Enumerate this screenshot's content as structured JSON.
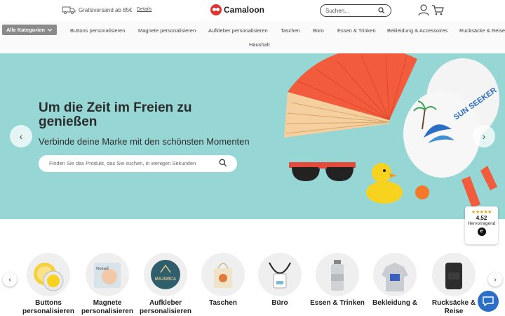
{
  "topbar": {
    "shipping_text": "Gratisversand ab 85€",
    "details_link": "Details",
    "logo_text": "Camaloon",
    "search_placeholder": "Suchen..."
  },
  "nav": {
    "all_categories": "Alle Kategorien",
    "items": [
      "Buttons personalisieren",
      "Magnete personalisieren",
      "Aufkleber personalisieren",
      "Taschen",
      "Büro",
      "Essen & Trinken",
      "Bekleidung & Accessoires",
      "Rucksäcke & Reise",
      "Haushalt"
    ]
  },
  "hero": {
    "title": "Um die Zeit im Freien zu genießen",
    "subtitle": "Verbinde deine Marke mit den schönsten Momenten",
    "search_placeholder": "Finden Sie das Produkt, das Sie suchen, in wenigen Sekunden",
    "prev_arrow": "‹",
    "next_arrow": "›",
    "paddle_text": "SUN SEEKER"
  },
  "rating": {
    "stars": "★★★★★",
    "score": "4,52",
    "label": "Hervorragend",
    "badge_letter": "e"
  },
  "categories": [
    {
      "label": "Buttons personalisieren"
    },
    {
      "label": "Magnete personalisieren"
    },
    {
      "label": "Aufkleber personalisieren"
    },
    {
      "label": "Taschen"
    },
    {
      "label": "Büro"
    },
    {
      "label": "Essen & Trinken"
    },
    {
      "label": "Bekleidung &"
    },
    {
      "label": "Rucksäcke & Reise"
    }
  ],
  "category_nav": {
    "prev": "‹",
    "next": "›"
  },
  "image_text": {
    "majorca": "MAJORCA",
    "magnet_word": "Nomad"
  },
  "colors": {
    "hero_bg": "#96d6d4",
    "brand_red": "#e0322e",
    "fan_orange": "#f25b3c",
    "chat_blue": "#2a6ec6"
  }
}
